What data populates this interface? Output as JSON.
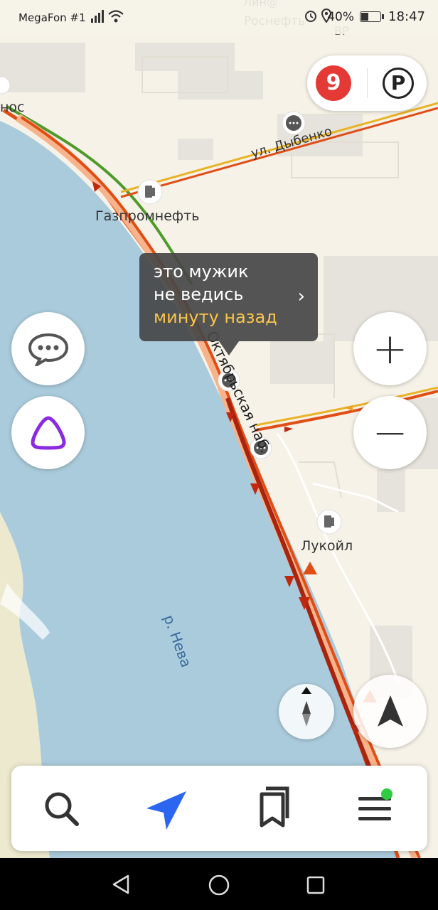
{
  "status_bar": {
    "carrier": "MegaFon #1",
    "battery": "40%",
    "battery_level": 0.4,
    "time": "18:47"
  },
  "map": {
    "labels": {
      "gazprom": "Газпромнефть",
      "lukoil": "Лукойл",
      "street_dybenko": "ул. Дыбенко",
      "embankment": "Октябрьская наб.",
      "river": "р. Нева",
      "rosneft": "Роснефть",
      "top_partial": "Лин@",
      "top_partial2": "ВР",
      "left_partial": "нос"
    }
  },
  "traffic": {
    "score": "9"
  },
  "parking": {
    "label": "P"
  },
  "popup": {
    "line1": "это мужик",
    "line2": "не ведись",
    "time": "минуту назад"
  },
  "controls": {
    "zoom_in": "+",
    "zoom_out": "−"
  },
  "bottom_nav": {
    "items": [
      {
        "name": "search",
        "icon": "search-icon"
      },
      {
        "name": "navigate",
        "icon": "navigation-arrow-icon"
      },
      {
        "name": "bookmarks",
        "icon": "bookmarks-icon"
      },
      {
        "name": "menu",
        "icon": "menu-icon"
      }
    ]
  },
  "colors": {
    "water": "#aacbdc",
    "land": "#f6f2e8",
    "traffic_red": "#e04e16",
    "traffic_dark": "#a8240f",
    "traffic_green": "#4e9a2a",
    "popup_time": "#f7c64a",
    "alice": "#8a2be2"
  }
}
